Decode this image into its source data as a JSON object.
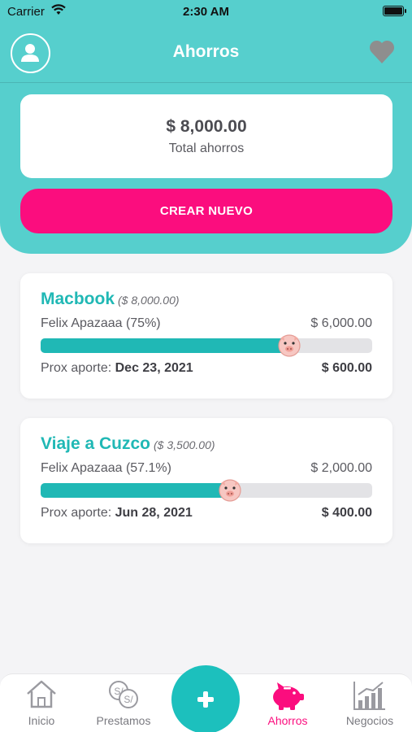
{
  "status_bar": {
    "carrier": "Carrier",
    "time": "2:30 AM"
  },
  "nav": {
    "title": "Ahorros"
  },
  "summary": {
    "total_amount": "$ 8,000.00",
    "total_label": "Total ahorros"
  },
  "actions": {
    "create_label": "CREAR NUEVO"
  },
  "savings": [
    {
      "name": "Macbook",
      "goal": "($ 8,000.00)",
      "owner": "Felix Apazaaa (75%)",
      "saved": "$ 6,000.00",
      "progress": 0.75,
      "next_label": "Prox aporte:",
      "next_date": "Dec 23, 2021",
      "next_amount": "$ 600.00"
    },
    {
      "name": "Viaje a Cuzco",
      "goal": "($ 3,500.00)",
      "owner": "Felix Apazaaa (57.1%)",
      "saved": "$ 2,000.00",
      "progress": 0.571,
      "next_label": "Prox aporte:",
      "next_date": "Jun 28, 2021",
      "next_amount": "$ 400.00"
    }
  ],
  "tabs": [
    {
      "label": "Inicio",
      "icon": "home-icon"
    },
    {
      "label": "Prestamos",
      "icon": "coins-icon"
    },
    {
      "label": "Ahorros",
      "icon": "piggy-bank-icon",
      "active": true
    },
    {
      "label": "Negocios",
      "icon": "chart-icon"
    }
  ],
  "colors": {
    "teal": "#56cfcd",
    "accent": "#20b8b5",
    "pink": "#fb0d7e"
  }
}
